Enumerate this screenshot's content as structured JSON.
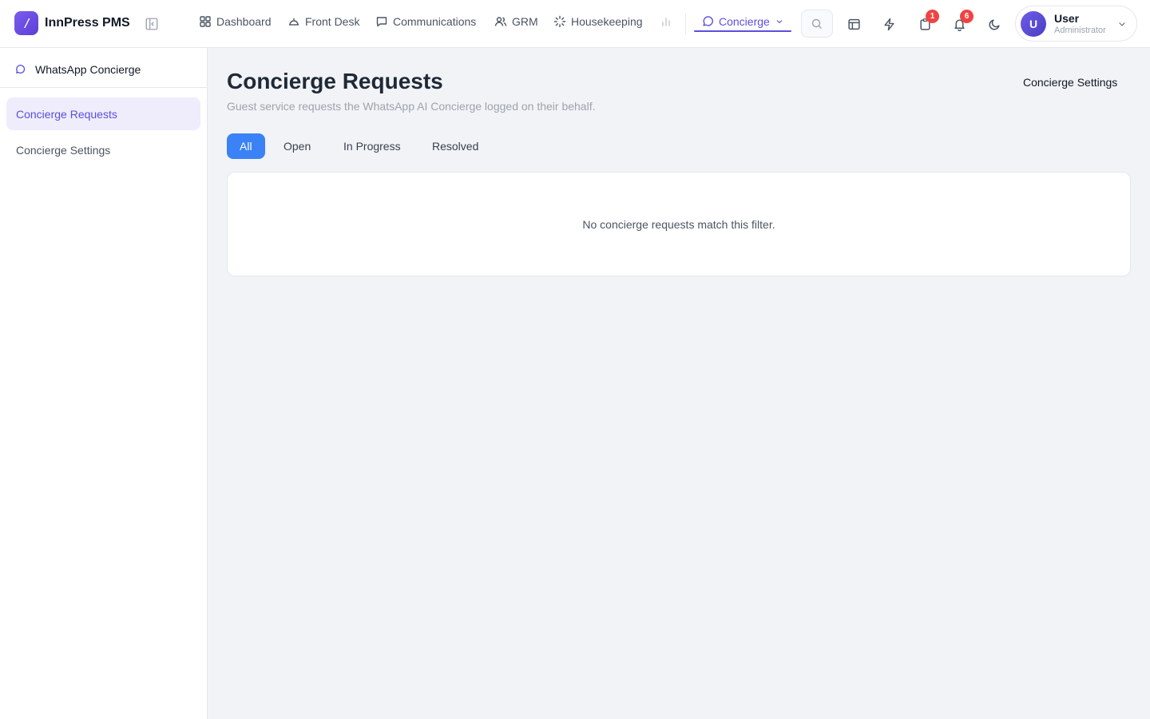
{
  "app": {
    "brand": "InnPress PMS"
  },
  "nav": {
    "items": [
      {
        "label": "Dashboard",
        "icon": "grid-icon"
      },
      {
        "label": "Front Desk",
        "icon": "bell-desk-icon"
      },
      {
        "label": "Communications",
        "icon": "message-icon"
      },
      {
        "label": "GRM",
        "icon": "users-icon"
      },
      {
        "label": "Housekeeping",
        "icon": "sparkle-icon"
      },
      {
        "label": "",
        "icon": "bar-chart-icon"
      }
    ],
    "active": {
      "label": "Concierge",
      "icon": "message-circle-icon"
    }
  },
  "toolbar": {
    "badges": {
      "tasks": "1",
      "notifications": "6"
    }
  },
  "user": {
    "initial": "U",
    "name": "User",
    "role": "Administrator"
  },
  "sidebar": {
    "title": "WhatsApp Concierge",
    "items": [
      {
        "label": "Concierge Requests",
        "active": true
      },
      {
        "label": "Concierge Settings",
        "active": false
      }
    ]
  },
  "main": {
    "title": "Concierge Requests",
    "subtitle": "Guest service requests the WhatsApp AI Concierge logged on their behalf.",
    "settings_link": "Concierge Settings",
    "filters": [
      "All",
      "Open",
      "In Progress",
      "Resolved"
    ],
    "active_filter": "All",
    "empty_message": "No concierge requests match this filter."
  },
  "colors": {
    "accent": "#5b4ee0",
    "primary_button": "#3b82f6",
    "badge": "#ef4444"
  }
}
